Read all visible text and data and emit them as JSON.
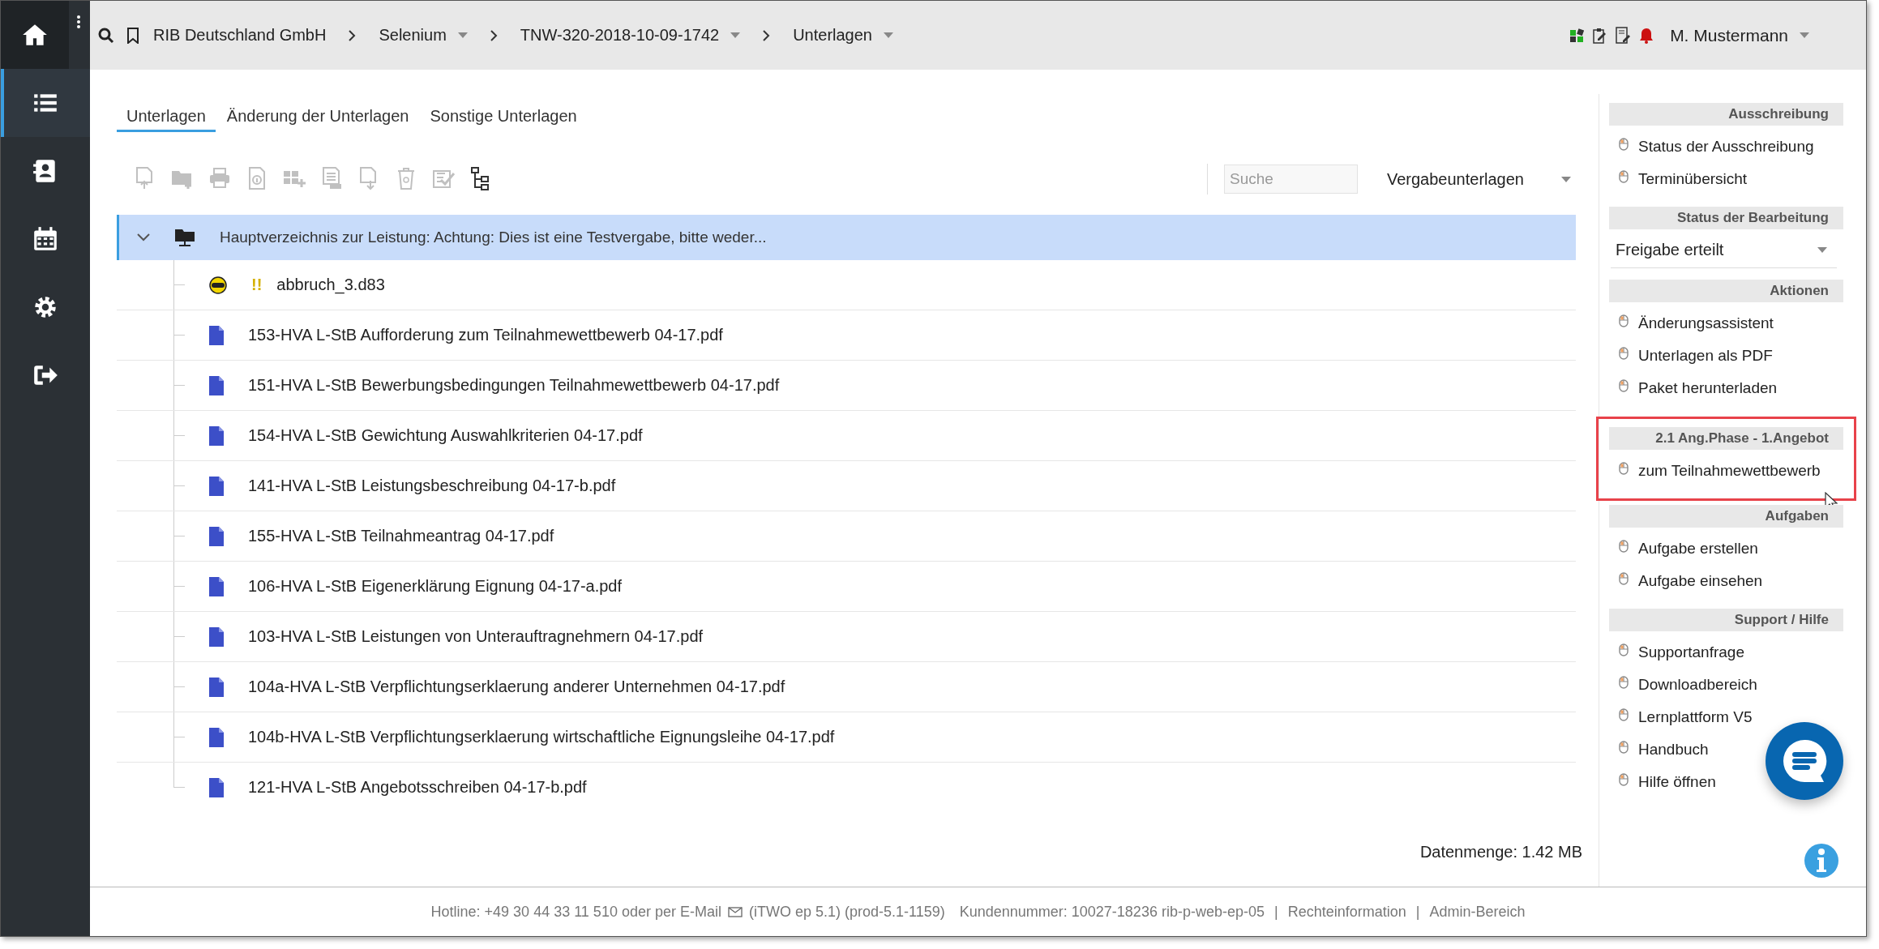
{
  "sidebar": {
    "items": [
      {
        "selected": false
      },
      {
        "selected": true
      },
      {
        "selected": false
      },
      {
        "selected": false
      },
      {
        "selected": false
      },
      {
        "selected": false
      }
    ]
  },
  "breadcrumb": [
    {
      "label": "RIB Deutschland GmbH",
      "dropdown": false
    },
    {
      "label": "Selenium",
      "dropdown": true
    },
    {
      "label": "TNW-320-2018-10-09-1742",
      "dropdown": true
    },
    {
      "label": "Unterlagen",
      "dropdown": true
    }
  ],
  "user": {
    "name": "M. Mustermann"
  },
  "tabs": [
    {
      "label": "Unterlagen",
      "selected": true
    },
    {
      "label": "Änderung der Unterlagen",
      "selected": false
    },
    {
      "label": "Sonstige Unterlagen",
      "selected": false
    }
  ],
  "toolbar": {
    "buttons": [
      {
        "disabled": true
      },
      {
        "disabled": true
      },
      {
        "disabled": true
      },
      {
        "disabled": true
      },
      {
        "disabled": true
      },
      {
        "disabled": true
      },
      {
        "disabled": true
      },
      {
        "disabled": true
      },
      {
        "disabled": true
      },
      {
        "disabled": false
      }
    ],
    "search": {
      "placeholder": "Suche"
    },
    "filter": {
      "value": "Vergabeunterlagen"
    }
  },
  "tree": {
    "label": "Hauptverzeichnis zur Leistung: Achtung: Dies ist eine Testvergabe, bitte weder...",
    "expanded": true,
    "selected": true,
    "children": [
      {
        "kind": "d83",
        "name": "abbruch_3.d83",
        "flag": "!!"
      },
      {
        "kind": "pdf",
        "name": "153-HVA L-StB Aufforderung zum Teilnahmewettbewerb 04-17.pdf"
      },
      {
        "kind": "pdf",
        "name": "151-HVA L-StB Bewerbungsbedingungen Teilnahmewettbewerb 04-17.pdf"
      },
      {
        "kind": "pdf",
        "name": "154-HVA L-StB Gewichtung Auswahlkriterien 04-17.pdf"
      },
      {
        "kind": "pdf",
        "name": "141-HVA L-StB Leistungsbeschreibung 04-17-b.pdf"
      },
      {
        "kind": "pdf",
        "name": "155-HVA L-StB Teilnahmeantrag 04-17.pdf"
      },
      {
        "kind": "pdf",
        "name": "106-HVA L-StB Eigenerklärung Eignung 04-17-a.pdf"
      },
      {
        "kind": "pdf",
        "name": "103-HVA L-StB Leistungen von Unterauftragnehmern 04-17.pdf"
      },
      {
        "kind": "pdf",
        "name": "104a-HVA L-StB Verpflichtungserklaerung anderer Unternehmen 04-17.pdf"
      },
      {
        "kind": "pdf",
        "name": "104b-HVA L-StB Verpflichtungserklaerung wirtschaftliche Eignungsleihe 04-17.pdf"
      },
      {
        "kind": "pdf",
        "name": "121-HVA L-StB Angebotsschreiben 04-17-b.pdf"
      }
    ]
  },
  "data_size": "Datenmenge: 1.42 MB",
  "panel": {
    "sections": [
      {
        "kind": "links",
        "title": "Ausschreibung",
        "highlighted": false,
        "items": [
          "Status der Ausschreibung",
          "Terminübersicht"
        ]
      },
      {
        "kind": "select",
        "title": "Status der Bearbeitung",
        "highlighted": false,
        "value": "Freigabe erteilt"
      },
      {
        "kind": "links",
        "title": "Aktionen",
        "highlighted": false,
        "items": [
          "Änderungsassistent",
          "Unterlagen als PDF",
          "Paket herunterladen"
        ]
      },
      {
        "kind": "links",
        "title": "2.1 Ang.Phase - 1.Angebot",
        "highlighted": true,
        "items": [
          "zum Teilnahmewettbewerb"
        ]
      },
      {
        "kind": "links",
        "title": "Aufgaben",
        "highlighted": false,
        "items": [
          "Aufgabe erstellen",
          "Aufgabe einsehen"
        ]
      },
      {
        "kind": "links",
        "title": "Support / Hilfe",
        "highlighted": false,
        "items": [
          "Supportanfrage",
          "Downloadbereich",
          "Lernplattform V5",
          "Handbuch",
          "Hilfe öffnen"
        ]
      }
    ]
  },
  "footer": {
    "hotline": "Hotline: +49 30 44 33 11 510 oder per E-Mail",
    "version": "(iTWO ep 5.1) (prod-5.1-1159)",
    "customer": "Kundennummer: 10027-18236 rib-p-web-ep-05",
    "separator": "|",
    "links": [
      "Rechteinformation",
      "Admin-Bereich"
    ]
  }
}
